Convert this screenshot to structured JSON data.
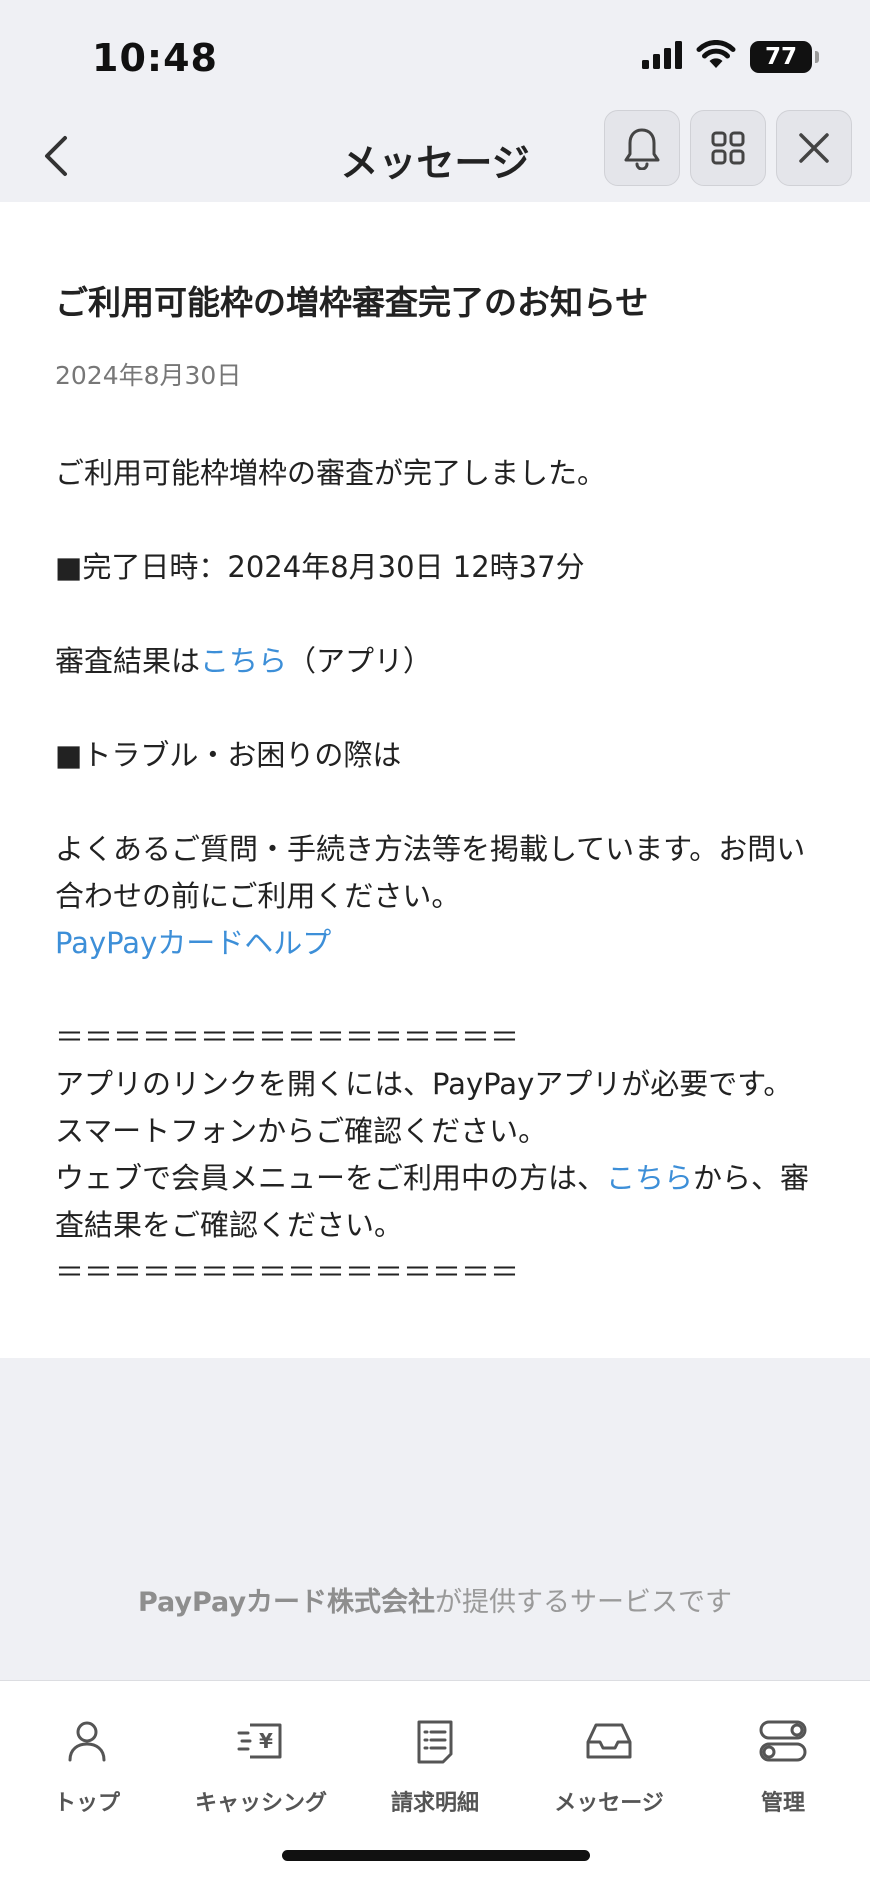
{
  "status_bar": {
    "time": "10:48",
    "battery": "77"
  },
  "nav": {
    "title": "メッセージ"
  },
  "message": {
    "title": "ご利用可能枠の増枠審査完了のお知らせ",
    "date": "2024年8月30日",
    "line1": "ご利用可能枠増枠の審査が完了しました。",
    "line2": "■完了日時：2024年8月30日 12時37分",
    "line3_before": "審査結果は",
    "line3_link": "こちら",
    "line3_after": "（アプリ）",
    "line4": "■トラブル・お困りの際は",
    "line5": "よくあるご質問・手続き方法等を掲載しています。お問い合わせの前にご利用ください。",
    "help_link": "PayPayカードヘルプ",
    "divider": "＝＝＝＝＝＝＝＝＝＝＝＝＝＝＝＝",
    "line6": "アプリのリンクを開くには、PayPayアプリが必要です。スマートフォンからご確認ください。",
    "line7_before": "ウェブで会員メニューをご利用中の方は、",
    "line7_link": "こちら",
    "line7_after": "から、審査結果をご確認ください。"
  },
  "footer": {
    "company": "PayPayカード株式会社",
    "suffix": "が提供するサービスです"
  },
  "tabs": [
    {
      "label": "トップ",
      "icon": "person-icon"
    },
    {
      "label": "キャッシング",
      "icon": "yen-cash-icon"
    },
    {
      "label": "請求明細",
      "icon": "statement-icon"
    },
    {
      "label": "メッセージ",
      "icon": "inbox-icon"
    },
    {
      "label": "管理",
      "icon": "toggle-settings-icon"
    }
  ],
  "colors": {
    "link": "#3d8fd8",
    "background": "#eff0f4",
    "card": "#ffffff"
  }
}
